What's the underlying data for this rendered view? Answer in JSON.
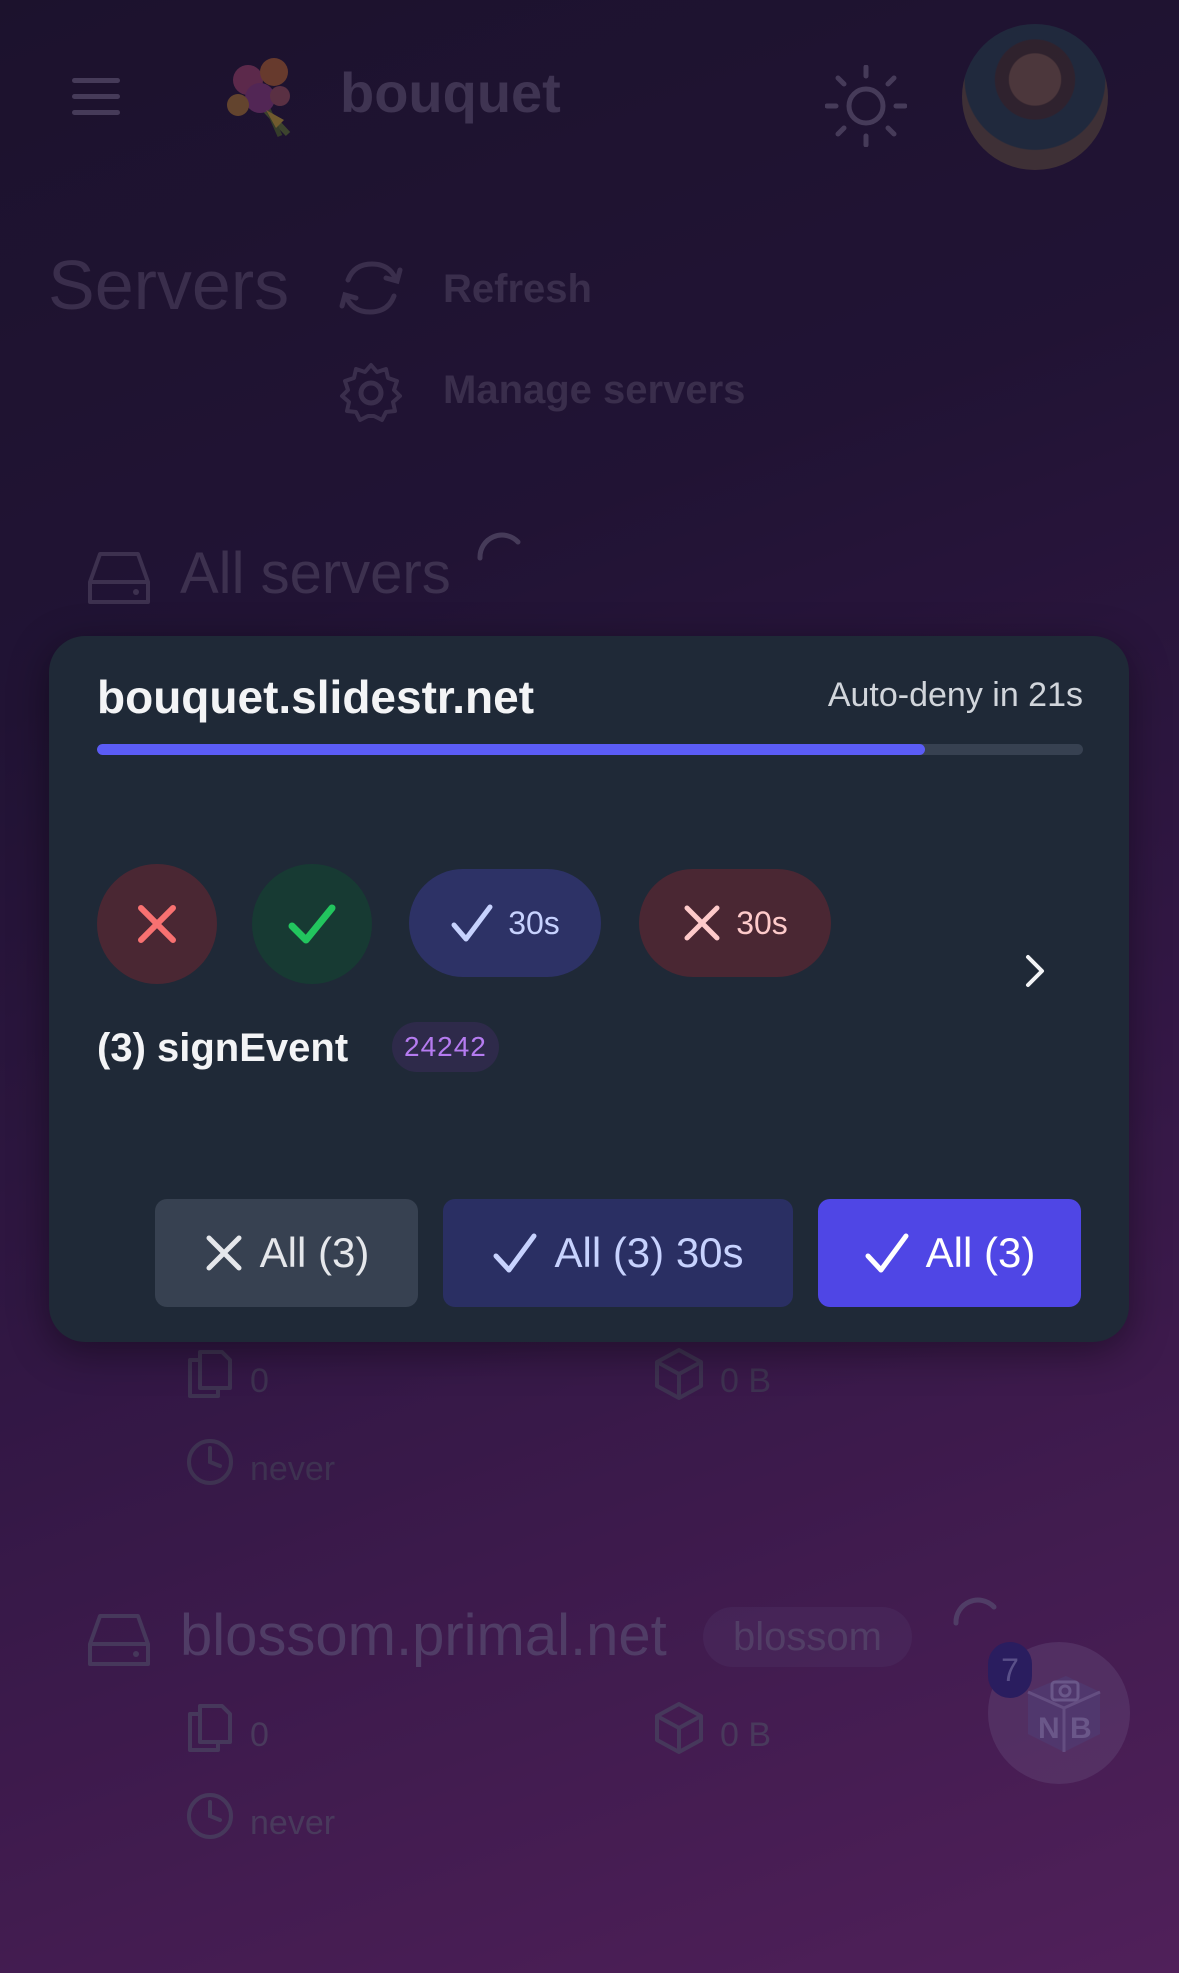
{
  "header": {
    "brand": "bouquet",
    "menu_icon": "hamburger-menu-icon",
    "logo_icon": "bouquet-logo-icon",
    "theme_icon": "sun-icon",
    "avatar_icon": "user-avatar"
  },
  "page": {
    "title": "Servers",
    "refresh_label": "Refresh",
    "manage_label": "Manage servers"
  },
  "all_servers": {
    "label": "All servers",
    "files": "0",
    "size": "0 B",
    "last": "never"
  },
  "blossom_server": {
    "name": "blossom.primal.net",
    "badge": "blossom",
    "files": "0",
    "size": "0 B",
    "last": "never"
  },
  "floating": {
    "icon": "nostr-bunker-icon",
    "count": "7"
  },
  "dialog": {
    "host": "bouquet.slidestr.net",
    "timer": "Auto-deny in 21s",
    "progress": 0.84,
    "deny_30s_label": "30s",
    "allow_30s_label": "30s",
    "method": "(3) signEvent",
    "kind": "24242",
    "btn_deny_all": "All (3)",
    "btn_allow_all_30s": "All (3) 30s",
    "btn_allow_all": "All (3)"
  },
  "colors": {
    "dialog_bg": "#1f2937",
    "accent": "#4f46e5",
    "progress": "#5b5cf6",
    "deny_red": "#f87171",
    "allow_green": "#22c55e"
  }
}
